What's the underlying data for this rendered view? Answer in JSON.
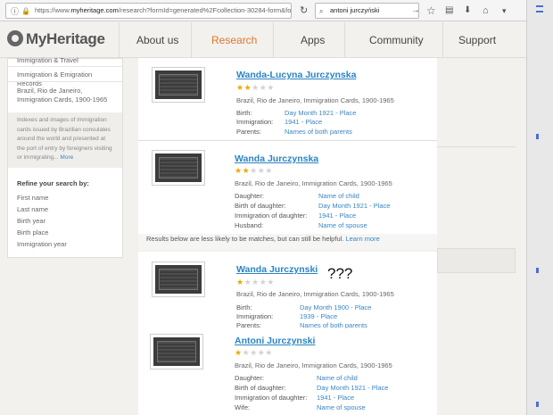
{
  "browser": {
    "url_prefix": "https://www.",
    "url_domain": "myheritage.com",
    "url_rest": "/research?formId=generated%2Fcollection-30284-form&formMo",
    "search_value": "antoni jurczyński",
    "back_icon": "back-arrow-icon",
    "info_icon": "info-icon",
    "lock_icon": "lock-icon",
    "reload_icon": "reload-icon",
    "search_icon": "magnifier-icon"
  },
  "header": {
    "logo": "MyHeritage",
    "nav": [
      {
        "label": "About us"
      },
      {
        "label": "Research"
      },
      {
        "label": "Apps"
      },
      {
        "label": "Community"
      },
      {
        "label": "Support"
      }
    ]
  },
  "sidebar": {
    "crumbs": [
      "Immigration & Travel",
      "Immigration & Emigration Records",
      "Brazil, Rio de Janeiro, Immigration Cards, 1900-1965"
    ],
    "description": "Indexes and images of immigration cards issued by Brazilian consulates around the world and presented at the port of entry by foreigners visiting or immigrating...",
    "more_link": "More",
    "refine_title": "Refine your search by:",
    "filters": [
      "First name",
      "Last name",
      "Birth year",
      "Birth place",
      "Immigration year"
    ]
  },
  "notice": {
    "text": "Results below are less likely to be matches, but can still be helpful.",
    "link": "Learn more"
  },
  "annotation": "???",
  "results": [
    {
      "name": "Wanda-Lucyna Jurczynska",
      "rating": 2,
      "collection": "Brazil, Rio de Janeiro, Immigration Cards, 1900-1965",
      "fields": [
        {
          "label": "Birth:",
          "value": "Day Month 1921 - Place"
        },
        {
          "label": "Immigration:",
          "value": "1941 - Place"
        },
        {
          "label": "Parents:",
          "value": "Names of both parents"
        }
      ]
    },
    {
      "name": "Wanda Jurczynska",
      "rating": 2,
      "collection": "Brazil, Rio de Janeiro, Immigration Cards, 1900-1965",
      "fields": [
        {
          "label": "Daughter:",
          "value": "Name of child"
        },
        {
          "label": "Birth of daughter:",
          "value": "Day Month 1921 - Place"
        },
        {
          "label": "Immigration of daughter:",
          "value": "1941 - Place"
        },
        {
          "label": "Husband:",
          "value": "Name of spouse"
        }
      ]
    },
    {
      "name": "Wanda Jurczynski",
      "rating": 1,
      "collection": "Brazil, Rio de Janeiro, Immigration Cards, 1900-1965",
      "fields": [
        {
          "label": "Birth:",
          "value": "Day Month 1900 - Place"
        },
        {
          "label": "Immigration:",
          "value": "1939 - Place"
        },
        {
          "label": "Parents:",
          "value": "Names of both parents"
        }
      ]
    },
    {
      "name": "Antoni Jurczynski",
      "rating": 1,
      "collection": "Brazil, Rio de Janeiro, Immigration Cards, 1900-1965",
      "fields": [
        {
          "label": "Daughter:",
          "value": "Name of child"
        },
        {
          "label": "Birth of daughter:",
          "value": "Day Month 1921 - Place"
        },
        {
          "label": "Immigration of daughter:",
          "value": "1941 - Place"
        },
        {
          "label": "Wife:",
          "value": "Name of spouse"
        }
      ]
    }
  ],
  "colors": {
    "accent": "#e0762d",
    "link": "#2a84c4",
    "star": "#f0a800"
  }
}
